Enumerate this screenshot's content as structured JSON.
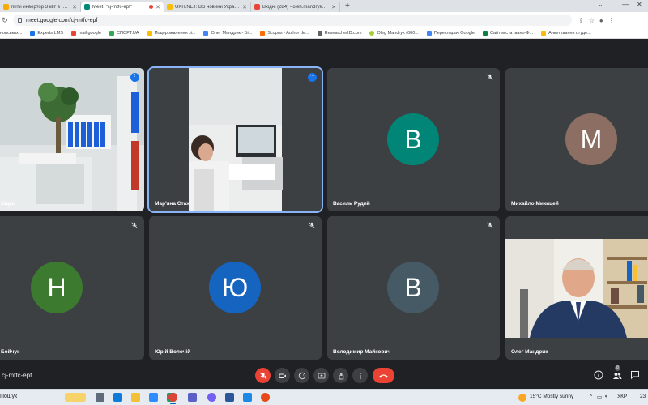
{
  "browser": {
    "tabs": [
      {
        "title": "пити инвертор 3 квт в Івано-",
        "favicon_color": "#f9ab00"
      },
      {
        "title": "Meet: \"cj-mtfc-epf\"",
        "favicon_color": "#00897b",
        "active": true,
        "recording": true
      },
      {
        "title": "UKR.NET: Всі новини України, с",
        "favicon_color": "#fbbc04"
      },
      {
        "title": "Вхідні (284) - oleh.mandryk@nu",
        "favicon_color": "#ea4335"
      }
    ],
    "new_tab": "+",
    "url": "meet.google.com/cj-mtfc-epf",
    "bookmarks": [
      {
        "label": "новських...",
        "color": "#9aa0a6"
      },
      {
        "label": "Experts LMS",
        "color": "#1a73e8"
      },
      {
        "label": "mail.google",
        "color": "#ea4335"
      },
      {
        "label": "СПОРТ.UA",
        "color": "#34a853"
      },
      {
        "label": "Подорожвлення зі...",
        "color": "#fbbc04"
      },
      {
        "label": "Олег Мандрик - Бі...",
        "color": "#4285f4"
      },
      {
        "label": "Scopus - Author de...",
        "color": "#ff6d00"
      },
      {
        "label": "ResearcherID.com",
        "color": "#5f6368"
      },
      {
        "label": "Oleg Mandryk (000...",
        "color": "#a6ce39"
      },
      {
        "label": "Перекладач Google",
        "color": "#4285f4"
      },
      {
        "label": "Сайт міста Івано-Ф...",
        "color": "#0b8043"
      },
      {
        "label": "Анкетування студе...",
        "color": "#fbbc04"
      }
    ]
  },
  "meeting": {
    "code": "cj-mtfc-epf",
    "participants": [
      {
        "name": "Бідко",
        "type": "video"
      },
      {
        "name": "Мар'яна Стах",
        "type": "video",
        "speaking": true
      },
      {
        "name": "Василь Рудий",
        "initial": "В",
        "avatar_color": "#008577"
      },
      {
        "name": "Михайло Микицей",
        "initial": "М",
        "avatar_color": "#8d6e63"
      },
      {
        "name": "Бойчук",
        "initial": "Н",
        "avatar_color": "#3c7a2f"
      },
      {
        "name": "Юрій Волочій",
        "initial": "Ю",
        "avatar_color": "#1565c0"
      },
      {
        "name": "Володимир Майкович",
        "initial": "В",
        "avatar_color": "#455a64"
      },
      {
        "name": "Олег Мандрик",
        "type": "video"
      }
    ],
    "people_count": "8"
  },
  "taskbar": {
    "search_label": "Пошук",
    "weather": "15°C  Mostly sunny",
    "language": "УКР",
    "clock": "23"
  }
}
